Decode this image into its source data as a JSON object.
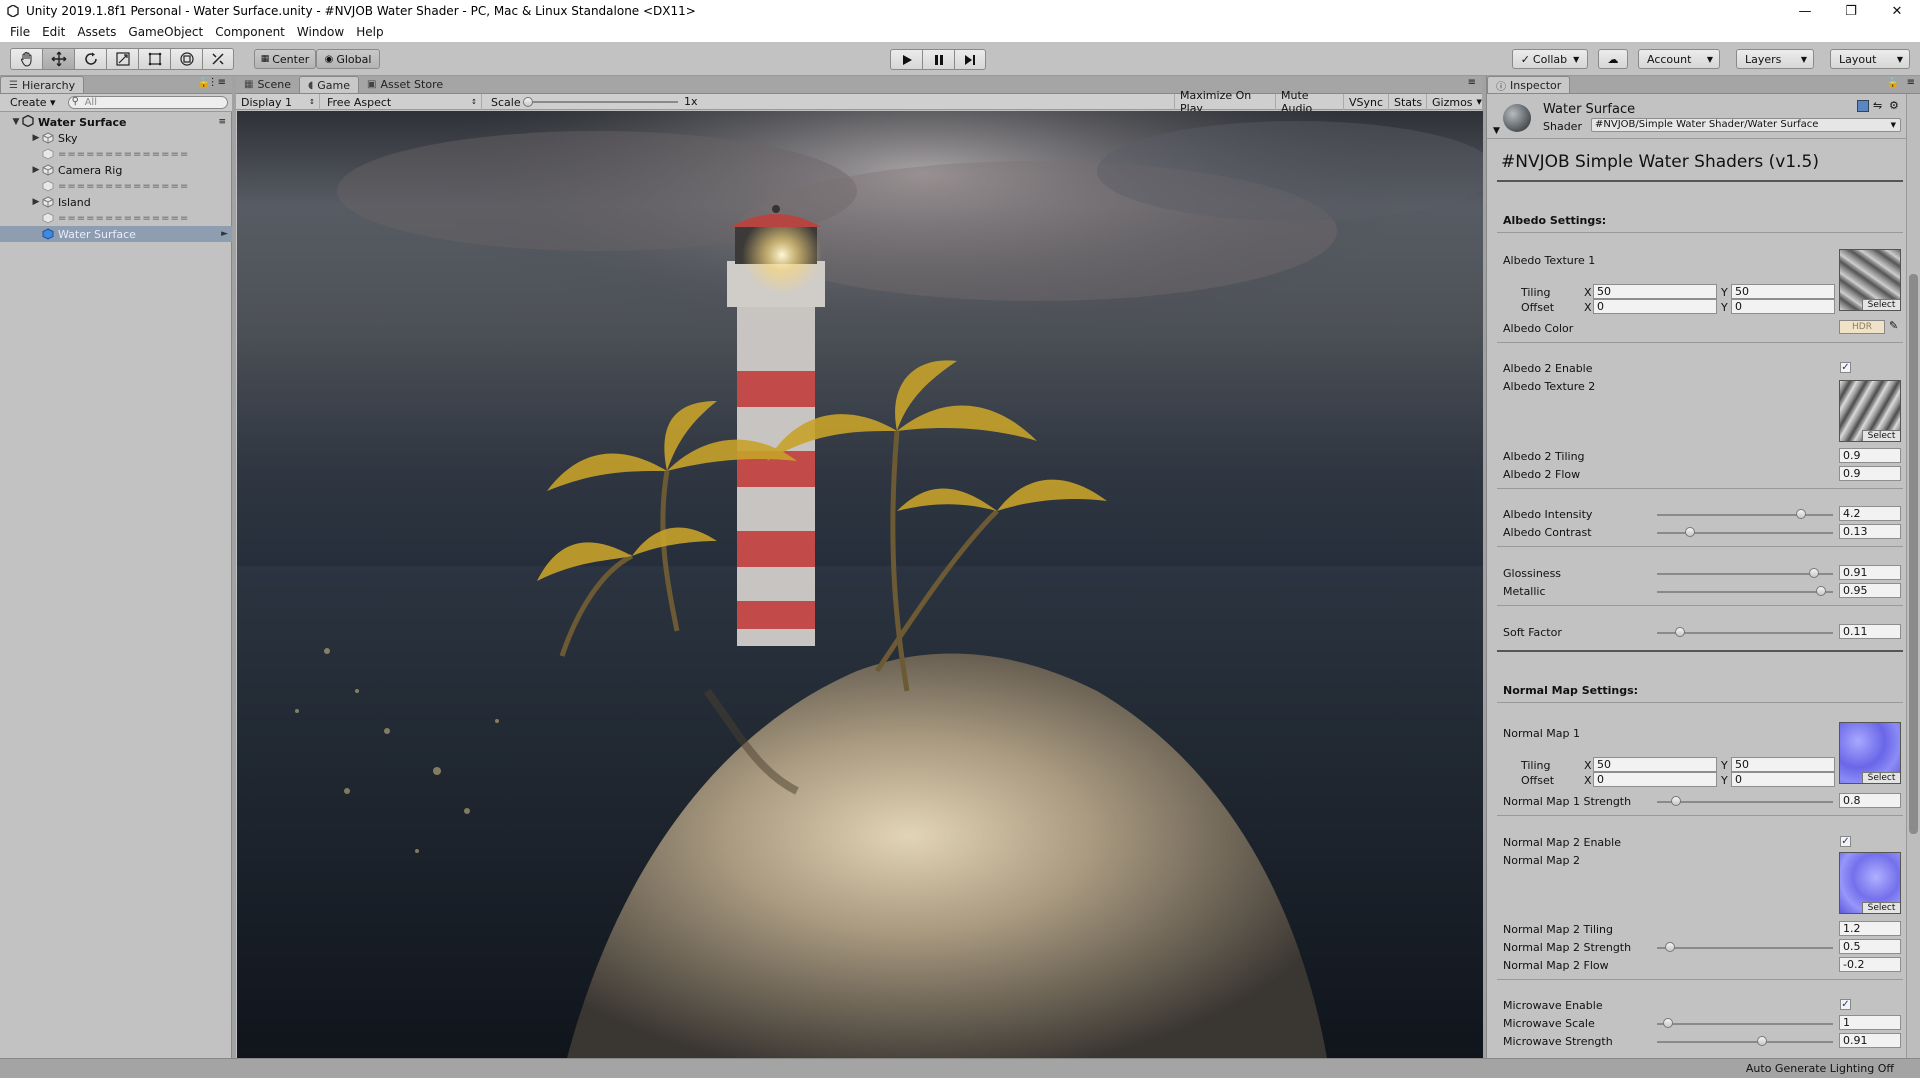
{
  "window": {
    "title": "Unity 2019.1.8f1 Personal - Water Surface.unity - #NVJOB Water Shader - PC, Mac & Linux Standalone <DX11>"
  },
  "menu": [
    "File",
    "Edit",
    "Assets",
    "GameObject",
    "Component",
    "Window",
    "Help"
  ],
  "toolbar": {
    "pivot": "Center",
    "space": "Global",
    "collab": "Collab",
    "account": "Account",
    "layers": "Layers",
    "layout": "Layout"
  },
  "hierarchy": {
    "tab": "Hierarchy",
    "create": "Create",
    "search_placeholder": "All",
    "scene": "Water Surface",
    "items": [
      {
        "label": "Sky"
      },
      {
        "label": "=============="
      },
      {
        "label": "Camera Rig"
      },
      {
        "label": "=============="
      },
      {
        "label": "Island"
      },
      {
        "label": "=============="
      },
      {
        "label": "Water Surface"
      }
    ]
  },
  "gameview": {
    "tabs": [
      "Scene",
      "Game",
      "Asset Store"
    ],
    "display": "Display 1",
    "aspect": "Free Aspect",
    "scale_label": "Scale",
    "scale_value": "1x",
    "buttons": [
      "Maximize On Play",
      "Mute Audio",
      "VSync",
      "Stats",
      "Gizmos"
    ]
  },
  "inspector": {
    "tab": "Inspector",
    "object_name": "Water Surface",
    "shader_label": "Shader",
    "shader_value": "#NVJOB/Simple Water Shader/Water Surface",
    "heading": "#NVJOB Simple Water Shaders (v1.5)",
    "albedo_section": "Albedo Settings:",
    "albedo_tex1": "Albedo Texture 1",
    "tiling": "Tiling",
    "offset": "Offset",
    "x": "X",
    "y": "Y",
    "tex1_tiling_x": "50",
    "tex1_tiling_y": "50",
    "tex1_offset_x": "0",
    "tex1_offset_y": "0",
    "albedo_color": "Albedo Color",
    "hdr": "HDR",
    "albedo2_enable": "Albedo 2 Enable",
    "albedo_tex2": "Albedo Texture 2",
    "albedo2_tiling": "Albedo 2 Tiling",
    "albedo2_tiling_val": "0.9",
    "albedo2_flow": "Albedo 2 Flow",
    "albedo2_flow_val": "0.9",
    "albedo_intensity": "Albedo Intensity",
    "albedo_intensity_val": "4.2",
    "albedo_contrast": "Albedo Contrast",
    "albedo_contrast_val": "0.13",
    "glossiness": "Glossiness",
    "glossiness_val": "0.91",
    "metallic": "Metallic",
    "metallic_val": "0.95",
    "soft_factor": "Soft Factor",
    "soft_factor_val": "0.11",
    "normal_section": "Normal Map Settings:",
    "normal1": "Normal Map 1",
    "nm1_tiling_x": "50",
    "nm1_tiling_y": "50",
    "nm1_offset_x": "0",
    "nm1_offset_y": "0",
    "nm1_strength": "Normal Map 1 Strength",
    "nm1_strength_val": "0.8",
    "nm2_enable": "Normal Map 2 Enable",
    "normal2": "Normal Map 2",
    "nm2_tiling": "Normal Map 2 Tiling",
    "nm2_tiling_val": "1.2",
    "nm2_strength": "Normal Map 2 Strength",
    "nm2_strength_val": "0.5",
    "nm2_flow": "Normal Map 2 Flow",
    "nm2_flow_val": "-0.2",
    "micro_enable": "Microwave Enable",
    "micro_scale": "Microwave Scale",
    "micro_scale_val": "1",
    "micro_strength": "Microwave Strength",
    "micro_strength_val": "0.91",
    "select": "Select"
  },
  "status": "Auto Generate Lighting Off",
  "colors": {
    "selection": "#8e9db0",
    "accent": "#1b3b86"
  }
}
